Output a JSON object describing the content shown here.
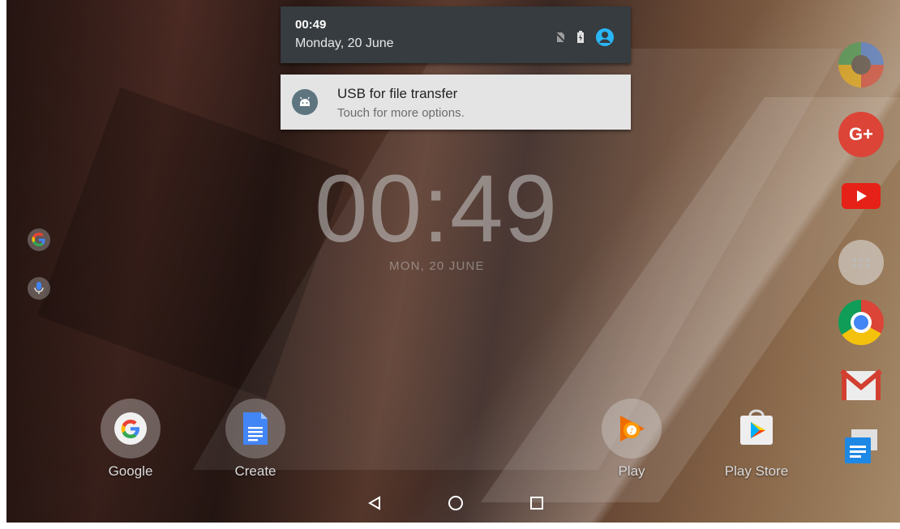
{
  "shade": {
    "time": "00:49",
    "date": "Monday, 20 June"
  },
  "notification": {
    "title": "USB for file transfer",
    "body": "Touch for more options."
  },
  "clock_widget": {
    "time": "00:49",
    "date": "MON, 20 JUNE"
  },
  "apps": [
    {
      "label": "Google",
      "icon": "google-folder-icon"
    },
    {
      "label": "Create",
      "icon": "google-docs-icon"
    },
    {
      "label": "Play",
      "icon": "play-music-icon"
    },
    {
      "label": "Play Store",
      "icon": "play-store-icon"
    }
  ],
  "dock": [
    "photos-icon",
    "google-plus-icon",
    "youtube-icon",
    "app-drawer-icon",
    "chrome-icon",
    "gmail-icon",
    "messenger-icon"
  ],
  "colors": {
    "accent": "#29b6f6",
    "gplus": "#db4437",
    "youtube": "#e62117",
    "gmail": "#d23f31"
  }
}
